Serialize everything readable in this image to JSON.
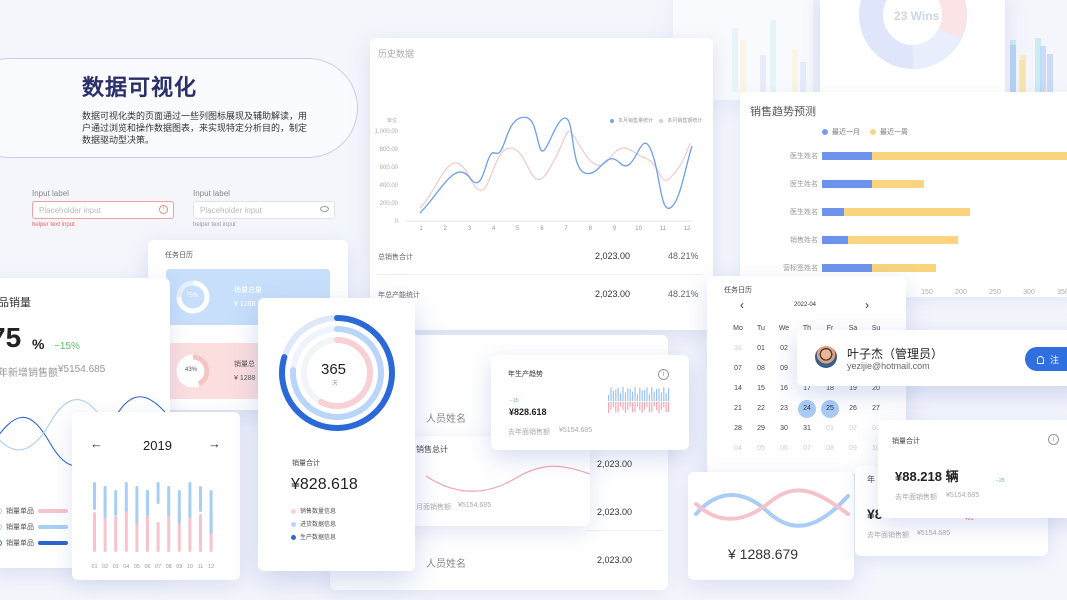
{
  "hero": {
    "title": "数据可视化",
    "desc1": "数据可视化类的页面通过一些列图标展现及辅助解读，用",
    "desc2": "户通过浏览和操作数据图表，来实现特定分析目的，制定",
    "desc3": "数据驱动型决策。"
  },
  "form": {
    "label1": "Input label",
    "label2": "Input label",
    "placeholder1": "Placeholder input",
    "placeholder2": "Placeholder input",
    "helper1": "helper text input",
    "helper2": "helper text input"
  },
  "history": {
    "title": "历史数据",
    "unit": "单位",
    "legend1": "本月销售量统计",
    "legend2": "本月销售额统计",
    "yticks": [
      "1,000.00",
      "800.00",
      "600.00",
      "400.00",
      "200.00",
      "0"
    ],
    "xticks": [
      "1",
      "2",
      "3",
      "4",
      "5",
      "6",
      "7",
      "8",
      "9",
      "10",
      "11",
      "12"
    ],
    "row1_label": "总销售合计",
    "row1_value": "2,023.00",
    "row1_pct": "48.21%",
    "row2_label": "年总产能统计",
    "row2_value": "2,023.00",
    "row2_pct": "48.21%"
  },
  "top_right": {
    "wins": "23 Wins"
  },
  "forecast": {
    "title": "销售趋势预测",
    "legend1": "最近一月",
    "legend2": "最近一周",
    "rows": [
      "医生姓名",
      "医生姓名",
      "医生姓名",
      "销售姓名",
      "营标签姓名"
    ],
    "xticks": [
      "150",
      "200",
      "250",
      "300",
      "350"
    ]
  },
  "product": {
    "title": "品销量",
    "value": "75",
    "unit": "%",
    "delta": "−15%",
    "sub": "年新增销售额",
    "sub_val": "¥5154.685",
    "legend": [
      "销量单品",
      "销量单品",
      "销量单品"
    ]
  },
  "task": {
    "title": "任务日历",
    "item1_pct": "75%",
    "item1_label": "销量总量",
    "item1_val": "¥ 1288",
    "item2_pct": "43%",
    "item2_label": "销量总",
    "item2_val": "¥ 1288"
  },
  "year_chart": {
    "year": "2019",
    "prev": "←",
    "next": "→",
    "months": [
      "01",
      "02",
      "03",
      "04",
      "05",
      "06",
      "07",
      "08",
      "09",
      "10",
      "11",
      "12"
    ]
  },
  "ring": {
    "days": "365",
    "unit": "天",
    "label": "销量合计",
    "value": "¥828.618",
    "legend": [
      "销售数量信息",
      "进货数据信息",
      "生产数据信息"
    ]
  },
  "mid_table": {
    "name1": "人员姓名",
    "sales_total": "销售总计",
    "val1": "2,023.00",
    "val2": "2,023.00",
    "val3": "2,023.00",
    "sub": "月面销售额",
    "sub_val": "¥5154.685",
    "name2": "人员姓名"
  },
  "prod_trend": {
    "title": "年生产趋势",
    "delta": "−15",
    "value": "¥828.618",
    "sub": "去年面销售额",
    "sub_val": "¥5154.685"
  },
  "calendar": {
    "title": "任务日历",
    "month": "2022-04",
    "weekdays": [
      "Mo",
      "Tu",
      "We",
      "Th",
      "Fr",
      "Sa",
      "Su"
    ],
    "rows": [
      [
        "31",
        "01",
        "02",
        "03",
        "04",
        "05",
        "06"
      ],
      [
        "07",
        "08",
        "09",
        "10",
        "11",
        "12",
        "13"
      ],
      [
        "14",
        "15",
        "16",
        "17",
        "18",
        "19",
        "20"
      ],
      [
        "21",
        "22",
        "23",
        "24",
        "25",
        "26",
        "27"
      ],
      [
        "28",
        "29",
        "30",
        "31",
        "01",
        "02",
        "03"
      ],
      [
        "04",
        "05",
        "06",
        "07",
        "08",
        "09",
        "10"
      ]
    ]
  },
  "user": {
    "name": "叶子杰（管理员）",
    "email": "yezijie@hotmail.com",
    "button": "注"
  },
  "wave_card": {
    "value": "¥ 1288.679"
  },
  "right_sales": {
    "title": "销量合计",
    "value": "¥88.218 辆",
    "delta": "−25",
    "sub": "去年面销售额",
    "sub_val": "¥5154.685",
    "value2": "¥8",
    "delta2": "+25",
    "label2": "年",
    "sub2": "去年面销售额",
    "sub2_val": "¥5154.685"
  }
}
